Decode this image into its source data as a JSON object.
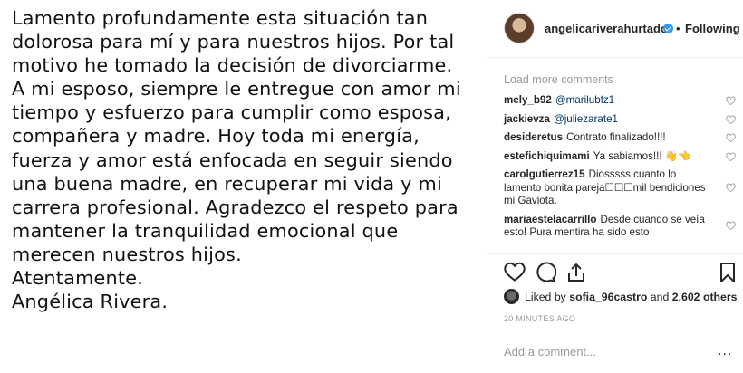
{
  "post": {
    "lines": [
      "Lamento profundamente esta situación tan",
      "dolorosa para mí y para nuestros hijos. Por tal",
      "motivo he tomado la decisión de divorciarme.",
      "A mi esposo, siempre le entregue con amor mi",
      "tiempo y esfuerzo para cumplir como esposa,",
      "compañera y madre. Hoy toda mi energía,",
      "fuerza y amor está enfocada en seguir siendo",
      "una buena madre, en recuperar mi vida y mi",
      "carrera profesional. Agradezco el respeto para",
      "mantener la tranquilidad emocional que",
      "merecen nuestros hijos.",
      "Atentamente.",
      "Angélica Rivera."
    ]
  },
  "header": {
    "username": "angelicariverahurtado",
    "separator": "•",
    "follow_status": "Following"
  },
  "comments_panel": {
    "load_more": "Load more comments",
    "comments": [
      {
        "user": "mely_b92",
        "text": "@marilubfz1"
      },
      {
        "user": "jackievza",
        "text": "@juliezarate1"
      },
      {
        "user": "desideretus",
        "text": "Contrato finalizado!!!!"
      },
      {
        "user": "estefichiquimami",
        "text": "Ya sabiamos!!! 👋👈"
      },
      {
        "user": "carolgutierrez15",
        "text": "Diosssss cuanto lo lamento bonita pareja☐☐☐mil bendiciones mi Gaviota."
      },
      {
        "user": "mariaestelacarrillo",
        "text": "Desde cuando se veía esto! Pura mentira ha sido esto"
      }
    ]
  },
  "likes": {
    "prefix": "Liked by",
    "user": "sofia_96castro",
    "middle": "and",
    "count": "2,602 others"
  },
  "timestamp": "20 MINUTES AGO",
  "add_comment": {
    "placeholder": "Add a comment...",
    "more": "..."
  },
  "icons": {
    "verified": "verified-badge-icon",
    "like": "heart-icon",
    "comment": "comment-bubble-icon",
    "share": "share-icon",
    "save": "bookmark-icon",
    "more": "more-options-icon"
  },
  "colors": {
    "verified": "#3897f0",
    "muted": "#999999",
    "text": "#262626",
    "mention": "#003569"
  }
}
